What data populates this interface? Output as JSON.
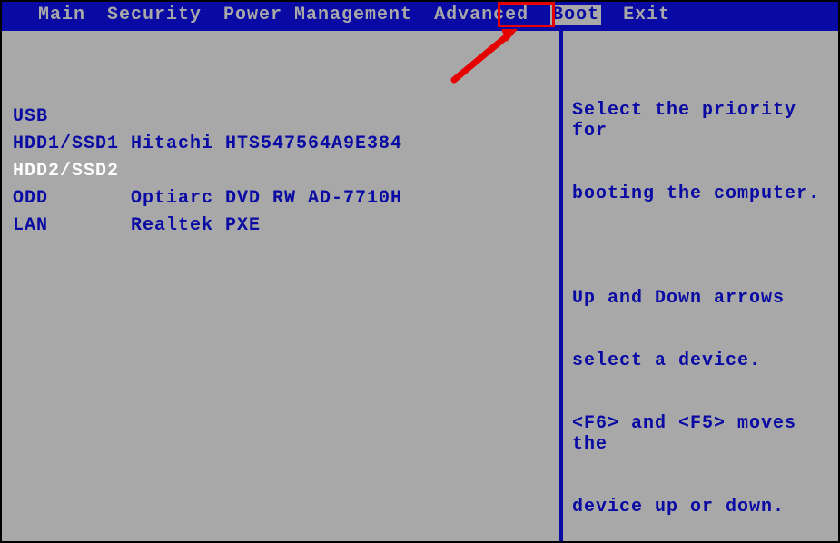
{
  "menu": {
    "items": [
      {
        "label": "Main",
        "active": false
      },
      {
        "label": "Security",
        "active": false
      },
      {
        "label": "Power Management",
        "active": false
      },
      {
        "label": "Advanced",
        "active": false
      },
      {
        "label": "Boot",
        "active": true
      },
      {
        "label": "Exit",
        "active": false
      }
    ]
  },
  "boot_order": [
    {
      "key": "USB",
      "value": "",
      "selected": false
    },
    {
      "key": "HDD1/SSD1",
      "value": "Hitachi HTS547564A9E384",
      "selected": false
    },
    {
      "key": "HDD2/SSD2",
      "value": "",
      "selected": true
    },
    {
      "key": "ODD",
      "value": "Optiarc DVD RW AD-7710H",
      "selected": false
    },
    {
      "key": "LAN",
      "value": "Realtek PXE",
      "selected": false
    }
  ],
  "help": {
    "line1": "Select the priority for",
    "line2": "booting the computer.",
    "line3": "",
    "line4": "Up and Down arrows",
    "line5": "select a device.",
    "line6": "<F6> and <F5> moves the",
    "line7": "device up or down."
  },
  "annotation": {
    "highlighted_tab": "Boot",
    "arrow_color": "#e60000"
  }
}
